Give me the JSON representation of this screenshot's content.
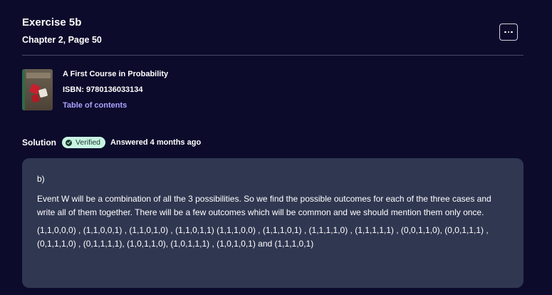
{
  "header": {
    "title": "Exercise 5b",
    "subtitle": "Chapter 2, Page 50"
  },
  "book": {
    "title": "A First Course in Probability",
    "isbn": "ISBN: 9780136033134",
    "toc_label": "Table of contents"
  },
  "solution": {
    "label": "Solution",
    "badge": "Verified",
    "answered": "Answered 4 months ago",
    "part": "b)",
    "intro": "Event W will be a combination of all the 3 possibilities. So we find the possible outcomes for each of the three cases and write all of them together. There will be a few outcomes which will be common and we should mention them only once.",
    "outcomes": "(1,1,0,0,0) , (1,1,0,0,1) , (1,1,0,1,0) , (1,1,0,1,1) (1,1,1,0,0) , (1,1,1,0,1) , (1,1,1,1,0) , (1,1,1,1,1) , (0,0,1,1,0), (0,0,1,1,1) , (0,1,1,1,0) , (0,1,1,1,1), (1,0,1,1,0), (1,0,1,1,1) , (1,0,1,0,1) and (1,1,1,0,1)"
  },
  "colors": {
    "background": "#0d0b2b",
    "card": "#303751",
    "accent_link": "#a9a4ff",
    "badge_bg": "#c8f3e3"
  }
}
